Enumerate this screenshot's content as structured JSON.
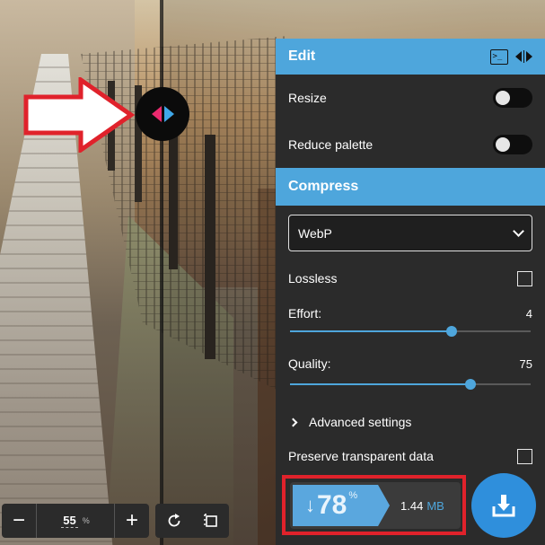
{
  "edit": {
    "title": "Edit",
    "resize_label": "Resize",
    "resize_on": false,
    "reduce_palette_label": "Reduce palette",
    "reduce_palette_on": false
  },
  "compress": {
    "title": "Compress",
    "format_selected": "WebP",
    "lossless_label": "Lossless",
    "lossless_checked": false,
    "effort_label": "Effort:",
    "effort_value": "4",
    "effort_fraction": 0.67,
    "quality_label": "Quality:",
    "quality_value": "75",
    "quality_fraction": 0.75,
    "advanced_label": "Advanced settings",
    "preserve_label": "Preserve transparent data",
    "preserve_checked": false
  },
  "result": {
    "arrow": "↓",
    "percent": "78",
    "percent_unit": "%",
    "size_value": "1.44",
    "size_unit": "MB"
  },
  "zoom": {
    "value": "55",
    "unit": "%",
    "minus": "−",
    "plus": "+"
  },
  "icons": {
    "terminal": "terminal-icon",
    "flip": "flip-sides-icon",
    "download": "download-icon",
    "rotate": "rotate-icon",
    "background": "background-toggle-icon"
  },
  "colors": {
    "accent": "#4ea6dc",
    "panel_bg": "#2b2b2b",
    "annotation_red": "#e0222b",
    "handle_left": "#ec2a6f",
    "handle_right": "#3fa7e8"
  }
}
